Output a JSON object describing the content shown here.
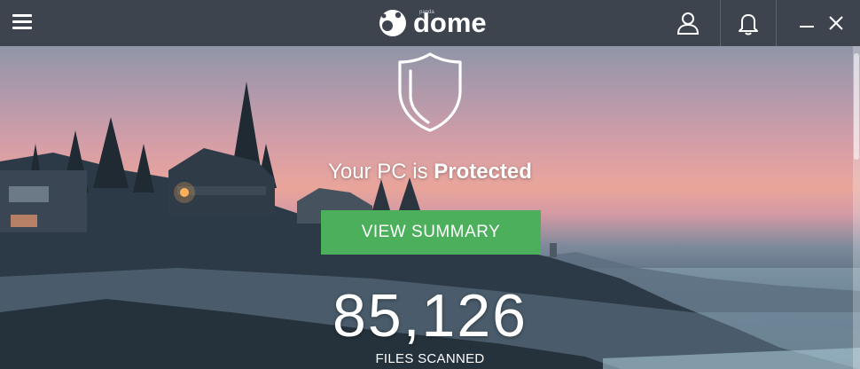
{
  "app": {
    "logo_text": "dome",
    "logo_tag": "panda"
  },
  "titlebar": {
    "icons": [
      "menu-icon",
      "panda-logo-icon",
      "user-icon",
      "bell-icon",
      "minimize-icon",
      "close-icon"
    ]
  },
  "status": {
    "prefix": "Your PC is ",
    "emphasis": "Protected"
  },
  "actions": {
    "view_summary_label": "VIEW SUMMARY"
  },
  "scan": {
    "files_count": "85,126",
    "files_label": "FILES SCANNED"
  },
  "colors": {
    "titlebar": "#3d444d",
    "accent_green": "#4caf5c",
    "text": "#ffffff"
  }
}
